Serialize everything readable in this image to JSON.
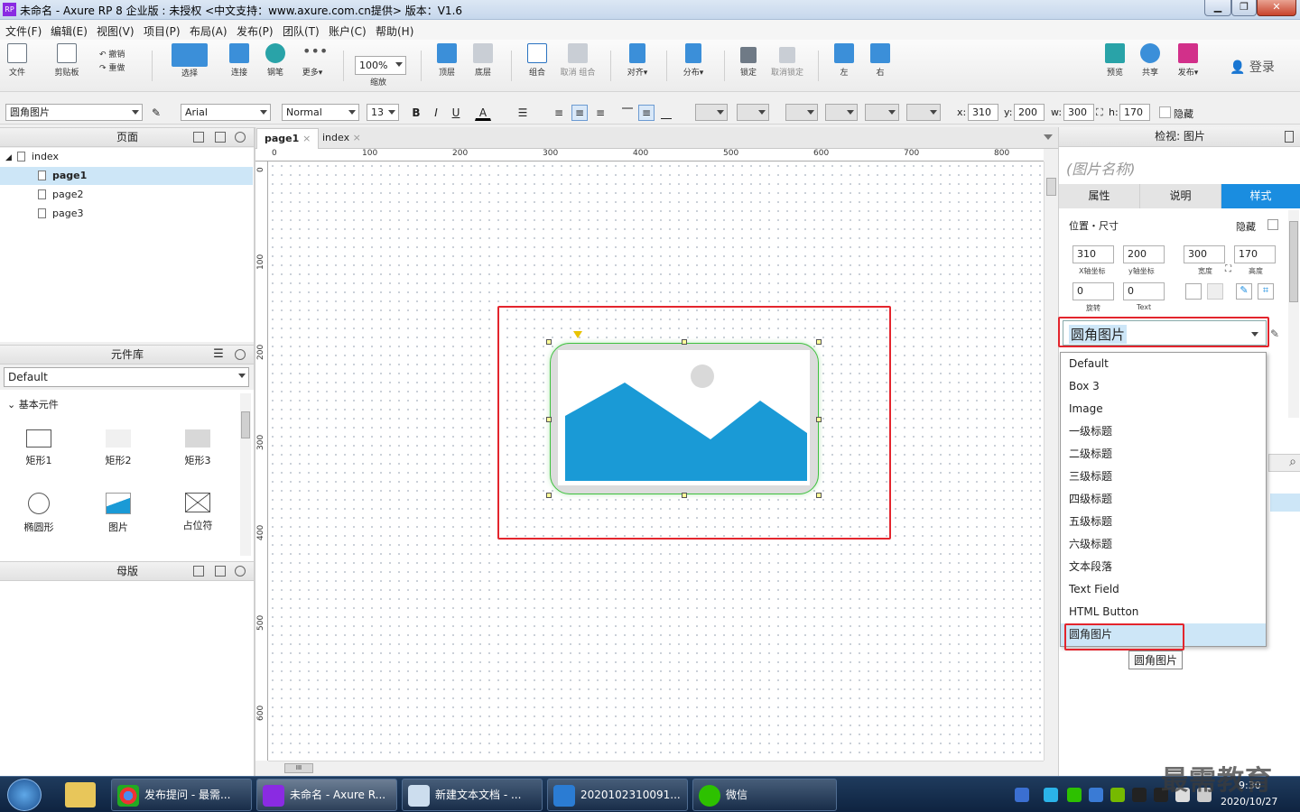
{
  "window": {
    "title": "未命名 - Axure RP 8 企业版 : 未授权      <中文支持：www.axure.com.cn提供> 版本：V1.6",
    "app_icon": "RP"
  },
  "menu": [
    "文件(F)",
    "编辑(E)",
    "视图(V)",
    "项目(P)",
    "布局(A)",
    "发布(P)",
    "团队(T)",
    "账户(C)",
    "帮助(H)"
  ],
  "toolbar": {
    "file": "文件",
    "clipboard": "剪贴板",
    "undo": "撤销",
    "redo": "重做",
    "select": "选择",
    "connect": "连接",
    "pen": "钢笔",
    "more": "更多▾",
    "zoom_value": "100%",
    "zoom": "缩放",
    "top": "顶层",
    "bottom": "底层",
    "group": "组合",
    "ungroup": "取消 组合",
    "align": "对齐▾",
    "distribute": "分布▾",
    "lock": "锁定",
    "unlock": "取消锁定",
    "left": "左",
    "right": "右",
    "preview": "预览",
    "share": "共享",
    "publish": "发布▾",
    "login": "登录"
  },
  "format": {
    "style": "圆角图片",
    "font": "Arial",
    "weight": "Normal",
    "size": "13",
    "bold": "B",
    "italic": "I",
    "underline": "U",
    "font_color": "A",
    "x_label": "x:",
    "x": "310",
    "y_label": "y:",
    "y": "200",
    "w_label": "w:",
    "w": "300",
    "h_label": "h:",
    "h": "170",
    "hidden": "隐藏"
  },
  "pages_panel": {
    "title": "页面",
    "items": [
      "index",
      "page1",
      "page2",
      "page3"
    ],
    "selected": "page1"
  },
  "library_panel": {
    "title": "元件库",
    "library": "Default",
    "group": "基本元件",
    "widgets": [
      "矩形1",
      "矩形2",
      "矩形3",
      "椭圆形",
      "图片",
      "占位符"
    ]
  },
  "masters_panel": {
    "title": "母版"
  },
  "canvas": {
    "tabs": [
      "page1",
      "index"
    ],
    "ruler_top": [
      "0",
      "100",
      "200",
      "300",
      "400",
      "500",
      "600",
      "700",
      "800"
    ],
    "ruler_left": [
      "0",
      "100",
      "200",
      "300",
      "400",
      "500",
      "600"
    ],
    "hscroll_grip": "III"
  },
  "inspector": {
    "title": "检视: 图片",
    "name_placeholder": "(图片名称)",
    "tabs": [
      "属性",
      "说明",
      "样式"
    ],
    "active_tab": "样式",
    "section": "位置・尺寸",
    "hidden": "隐藏",
    "x": "310",
    "x_label": "X轴坐标",
    "y": "200",
    "y_label": "y轴坐标",
    "w": "300",
    "w_label": "宽度",
    "h": "170",
    "h_label": "高度",
    "rotate": "0",
    "rotate_label": "旋转",
    "text_rotate": "0",
    "text_rotate_label": "Text",
    "style_value": "圆角图片",
    "tooltip": "圆角图片"
  },
  "style_options": [
    "Default",
    "Box 3",
    "Image",
    "一级标题",
    "二级标题",
    "三级标题",
    "四级标题",
    "五级标题",
    "六级标题",
    "文本段落",
    "Text Field",
    "HTML Button",
    "圆角图片"
  ],
  "taskbar": {
    "items": [
      "发布提问 - 最需...",
      "未命名 - Axure R...",
      "新建文本文档 - ...",
      "2020102310091...",
      "微信"
    ],
    "time": "9:30",
    "date": "2020/10/27",
    "watermark": "最需教育"
  },
  "colors": {
    "accent": "#1a8de0",
    "image_blue": "#1a9ad6",
    "highlight_red": "#e3252d",
    "selection_green": "#3fc13f"
  }
}
